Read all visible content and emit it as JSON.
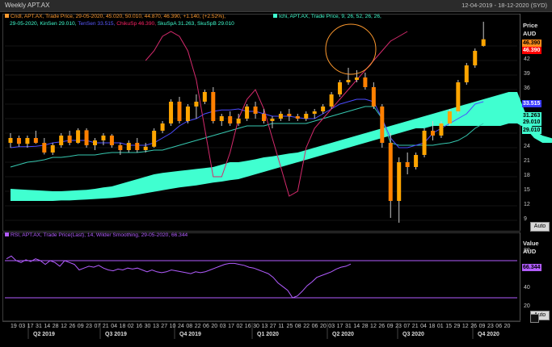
{
  "header": {
    "title": "Weekly APT.AX",
    "date_range": "12-04-2019 - 18-12-2020 (SYD)"
  },
  "legend_price": {
    "candle": "Cndl, APT.AX, Trade Price, 29-05-2020, 45.020, 50.010, 44.870, 46.390, +1.140, (+2.52%),",
    "ichi": "Ichi, APT.AX, Trade Price,  9, 26, 52, 26, 26,",
    "line2_a": "29-05-2020, KinSen 29.010,",
    "line2_b": "TenSen 33.515,",
    "line2_c": "ChikuSp 46.390,",
    "line2_d": "SkuSpA 31.263,",
    "line2_e": "SkuSpB 29.010"
  },
  "legend_rsi": "RSI, APT.AX, Trade Price(Last),  14, Wilder Smoothing, 29-05-2020, 66.344",
  "price_axis": {
    "head1": "Price",
    "head2": "AUD",
    "ticks": [
      "45",
      "42",
      "39",
      "36",
      "33",
      "30",
      "27",
      "24",
      "21",
      "18",
      "15",
      "12",
      "9"
    ],
    "tags": [
      {
        "text": "46.390",
        "bg": "#ff8c1a",
        "fg": "#000"
      },
      {
        "text": "46.390",
        "bg": "#ff0000",
        "fg": "#fff"
      },
      {
        "text": "33.515",
        "bg": "#3a3aff",
        "fg": "#fff"
      },
      {
        "text": "31.263",
        "bg": "#40ffd0",
        "fg": "#000"
      },
      {
        "text": "29.010",
        "bg": "#40ffd0",
        "fg": "#000"
      },
      {
        "text": "29.010",
        "bg": "#40ffd0",
        "fg": "#000"
      }
    ],
    "auto": "Auto"
  },
  "rsi_axis": {
    "head1": "Value",
    "head2": "AUD",
    "ticks": [
      "80",
      "60",
      "40",
      "20"
    ],
    "tag": {
      "text": "66.344",
      "bg": "#b25cff",
      "fg": "#000"
    },
    "auto": "Auto"
  },
  "x_axis": {
    "days": [
      "19",
      "03",
      "17",
      "31",
      "14",
      "28",
      "12",
      "26",
      "09",
      "23",
      "07",
      "21",
      "04",
      "18",
      "02",
      "16",
      "30",
      "13",
      "27",
      "10",
      "24",
      "08",
      "22",
      "06",
      "20",
      "03",
      "17",
      "02",
      "16",
      "30",
      "13",
      "27",
      "11",
      "25",
      "08",
      "22",
      "06",
      "20",
      "03",
      "17",
      "31",
      "14",
      "28",
      "12",
      "26",
      "09",
      "23",
      "07",
      "21",
      "04",
      "18",
      "01",
      "15",
      "29",
      "12",
      "26",
      "09",
      "23",
      "06",
      "20"
    ],
    "quarters": [
      "Q2 2019",
      "Q3 2019",
      "Q4 2019",
      "Q1 2020",
      "Q2 2020",
      "Q3 2020",
      "Q4 2020"
    ]
  },
  "chart_data": {
    "type": "candlestick",
    "ichimoku_params": [
      9,
      26,
      52,
      26,
      26
    ],
    "y_range": [
      7.5,
      49.5
    ],
    "rsi_range": [
      10,
      90
    ],
    "rsi_bands": [
      70,
      30
    ],
    "last": {
      "date": "29-05-2020",
      "open": 45.02,
      "high": 50.01,
      "low": 44.87,
      "close": 46.39,
      "change": 1.14,
      "change_pct": 2.52,
      "kinsen": 29.01,
      "tensen": 33.515,
      "chikusp": 46.39,
      "skuspa": 31.263,
      "skuspb": 29.01,
      "rsi": 66.344
    },
    "candles": [
      [
        25.0,
        27.0,
        24.0,
        26.0
      ],
      [
        26.0,
        26.5,
        24.2,
        24.8
      ],
      [
        24.8,
        26.5,
        24.0,
        26.0
      ],
      [
        26.0,
        27.5,
        24.8,
        25.0
      ],
      [
        25.0,
        26.0,
        22.6,
        23.0
      ],
      [
        23.0,
        25.0,
        22.5,
        24.5
      ],
      [
        24.5,
        27.0,
        24.0,
        26.5
      ],
      [
        26.5,
        27.5,
        24.5,
        25.0
      ],
      [
        25.0,
        28.0,
        24.8,
        27.6
      ],
      [
        27.6,
        28.0,
        24.0,
        24.5
      ],
      [
        24.5,
        26.0,
        23.5,
        25.5
      ],
      [
        25.5,
        27.0,
        24.5,
        26.5
      ],
      [
        26.5,
        26.8,
        24.0,
        24.5
      ],
      [
        24.5,
        25.0,
        22.5,
        23.5
      ],
      [
        23.5,
        25.5,
        23.0,
        25.0
      ],
      [
        25.0,
        26.0,
        23.0,
        23.5
      ],
      [
        23.5,
        25.0,
        23.0,
        24.2
      ],
      [
        24.2,
        28.0,
        24.0,
        27.5
      ],
      [
        27.5,
        29.5,
        27.0,
        29.0
      ],
      [
        29.0,
        34.0,
        28.5,
        33.5
      ],
      [
        33.5,
        34.5,
        29.0,
        29.5
      ],
      [
        29.5,
        33.0,
        29.0,
        32.5
      ],
      [
        32.5,
        35.0,
        30.0,
        33.5
      ],
      [
        33.5,
        36.0,
        33.0,
        35.5
      ],
      [
        35.5,
        36.5,
        29.0,
        29.5
      ],
      [
        29.5,
        31.0,
        28.5,
        30.5
      ],
      [
        30.5,
        31.5,
        28.5,
        29.0
      ],
      [
        29.0,
        31.0,
        28.5,
        30.0
      ],
      [
        30.0,
        33.0,
        29.5,
        32.5
      ],
      [
        32.5,
        33.5,
        30.0,
        31.0
      ],
      [
        31.0,
        32.0,
        29.0,
        29.5
      ],
      [
        29.5,
        30.5,
        28.0,
        30.0
      ],
      [
        30.0,
        31.5,
        29.5,
        31.0
      ],
      [
        31.0,
        32.0,
        29.5,
        30.5
      ],
      [
        30.5,
        31.0,
        29.5,
        30.0
      ],
      [
        30.0,
        31.5,
        29.5,
        31.0
      ],
      [
        31.0,
        32.0,
        30.0,
        31.5
      ],
      [
        31.5,
        33.0,
        31.0,
        32.5
      ],
      [
        32.5,
        35.5,
        32.0,
        35.0
      ],
      [
        35.0,
        38.0,
        34.5,
        37.5
      ],
      [
        37.5,
        40.5,
        37.0,
        38.0
      ],
      [
        38.0,
        40.0,
        37.5,
        38.5
      ],
      [
        38.5,
        39.5,
        36.0,
        36.5
      ],
      [
        36.5,
        37.5,
        32.0,
        32.5
      ],
      [
        32.5,
        33.0,
        24.0,
        25.0
      ],
      [
        25.0,
        27.0,
        9.5,
        13.0
      ],
      [
        13.0,
        22.0,
        8.5,
        21.0
      ],
      [
        21.0,
        23.0,
        18.5,
        20.0
      ],
      [
        20.0,
        23.0,
        19.5,
        22.5
      ],
      [
        22.5,
        28.0,
        22.0,
        27.5
      ],
      [
        27.5,
        29.5,
        25.5,
        26.5
      ],
      [
        26.5,
        29.5,
        26.0,
        29.0
      ],
      [
        29.0,
        32.0,
        28.5,
        31.5
      ],
      [
        31.5,
        38.0,
        31.0,
        37.5
      ],
      [
        37.5,
        41.5,
        37.0,
        41.0
      ],
      [
        41.0,
        44.5,
        40.5,
        44.0
      ],
      [
        45.02,
        50.01,
        44.87,
        46.39
      ]
    ],
    "tensen": [
      24.0,
      24.2,
      24.2,
      24.3,
      24.5,
      25.0,
      25.2,
      25.5,
      25.5,
      25.5,
      25.0,
      25.0,
      25.0,
      25.0,
      24.5,
      24.5,
      24.5,
      25.0,
      26.0,
      27.0,
      28.5,
      29.5,
      30.0,
      31.0,
      31.5,
      31.8,
      31.8,
      32.0,
      31.5,
      31.5,
      31.0,
      30.5,
      30.5,
      30.5,
      30.2,
      30.0,
      30.0,
      31.0,
      32.0,
      33.0,
      33.5,
      34.0,
      34.0,
      33.5,
      30.0,
      26.0,
      24.0,
      24.0,
      24.5,
      25.0,
      27.0,
      28.0,
      29.0,
      30.0,
      31.0,
      33.0,
      33.5
    ],
    "kinsen": [
      20.0,
      20.5,
      21.0,
      21.2,
      21.5,
      22.0,
      22.0,
      22.2,
      22.5,
      22.5,
      22.5,
      22.8,
      23.0,
      23.0,
      23.0,
      23.0,
      23.2,
      23.5,
      23.5,
      24.0,
      24.5,
      25.0,
      25.5,
      26.0,
      26.5,
      27.0,
      27.5,
      28.0,
      28.5,
      28.5,
      28.5,
      29.0,
      29.0,
      29.0,
      29.0,
      29.0,
      29.5,
      30.0,
      30.5,
      31.0,
      31.5,
      32.0,
      32.5,
      32.5,
      30.0,
      25.0,
      24.5,
      24.5,
      24.5,
      24.5,
      24.5,
      24.8,
      25.0,
      25.5,
      26.5,
      28.0,
      29.01
    ],
    "chikou": [
      42,
      44,
      47,
      48,
      47,
      44,
      38,
      28,
      18,
      18,
      23,
      30,
      34,
      36,
      32,
      26,
      20,
      14,
      15,
      24,
      28,
      30,
      32,
      34,
      36,
      38,
      40,
      42,
      44,
      46,
      47,
      48
    ],
    "spanA": [
      15.5,
      15.4,
      15.3,
      15.2,
      15.1,
      15.0,
      15.0,
      15.1,
      15.2,
      15.3,
      15.5,
      15.8,
      16.0,
      16.5,
      17.0,
      17.5,
      18.0,
      18.5,
      18.8,
      19.0,
      19.2,
      19.4,
      19.6,
      19.8,
      20.0,
      20.5,
      21.0,
      21.0,
      21.3,
      21.6,
      22.0,
      22.2,
      22.5,
      22.8,
      23.0,
      23.5,
      24.0,
      24.5,
      25.0,
      25.5,
      26.0,
      26.5,
      27.0,
      27.5,
      28.0,
      28.5,
      29.0,
      29.5,
      30.0,
      30.5,
      31.0,
      31.5,
      32.0,
      32.5,
      33.0,
      33.5,
      34.0,
      34.5,
      35.0,
      35.5,
      35.5,
      31.0,
      27.5,
      26.5,
      26.0,
      25.5,
      25.0,
      24.5,
      24.0,
      24.5,
      25.5,
      27.0,
      29.0,
      31.263
    ],
    "spanB": [
      13.0,
      13.0,
      13.0,
      13.0,
      13.0,
      13.0,
      13.1,
      13.1,
      13.2,
      13.3,
      13.4,
      13.5,
      13.6,
      13.8,
      14.0,
      14.3,
      14.6,
      14.9,
      15.2,
      15.5,
      15.8,
      16.0,
      16.2,
      16.5,
      16.8,
      17.0,
      17.3,
      17.5,
      18.0,
      18.5,
      19.0,
      19.5,
      20.0,
      20.5,
      21.0,
      21.5,
      22.0,
      22.5,
      23.0,
      23.5,
      24.0,
      24.5,
      25.0,
      25.5,
      26.0,
      26.5,
      27.0,
      27.5,
      28.0,
      28.0,
      28.5,
      28.5,
      28.5,
      28.5,
      28.5,
      28.5,
      28.5,
      28.5,
      28.5,
      29.0,
      29.0,
      28.0,
      26.0,
      25.0,
      25.0,
      25.0,
      25.0,
      23.5,
      23.0,
      24.0,
      25.5,
      27.0,
      28.5,
      29.01
    ],
    "rsi": [
      72,
      75,
      70,
      68,
      71,
      69,
      72,
      70,
      66,
      70,
      68,
      64,
      70,
      68,
      66,
      60,
      62,
      64,
      63,
      65,
      62,
      60,
      59,
      61,
      60,
      62,
      61,
      62,
      60,
      58,
      60,
      58,
      57,
      58,
      60,
      59,
      58,
      57,
      56,
      58,
      57,
      58,
      60,
      62,
      64,
      66,
      67,
      67,
      66,
      65,
      63,
      62,
      60,
      58,
      56,
      52,
      46,
      42,
      38,
      30,
      32,
      37,
      43,
      47,
      52,
      54,
      56,
      58,
      61,
      63,
      64,
      66.344
    ]
  }
}
